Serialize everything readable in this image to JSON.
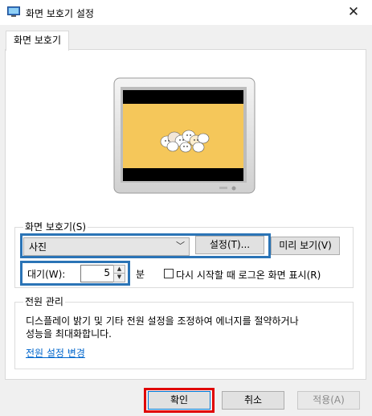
{
  "window": {
    "title": "화면 보호기 설정",
    "close_glyph": "✕"
  },
  "tabs": [
    {
      "label": "화면 보호기",
      "active": true
    }
  ],
  "screensaver": {
    "group_label": "화면 보호기(S)",
    "selected": "사진",
    "settings_button": "설정(T)...",
    "preview_button": "미리 보기(V)",
    "wait_label": "대기(W):",
    "wait_value": "5",
    "wait_unit": "분",
    "resume_checkbox_label": "다시 시작할 때 로그온 화면 표시(R)",
    "resume_checked": false
  },
  "power": {
    "group_label": "전원 관리",
    "description_line1": "디스플레이 밝기 및 기타 전원 설정을 조정하여 에너지를 절약하거나",
    "description_line2": "성능을 최대화합니다.",
    "link": "전원 설정 변경"
  },
  "footer": {
    "ok": "확인",
    "cancel": "취소",
    "apply": "적용(A)"
  },
  "colors": {
    "highlight_blue": "#2b74b6",
    "highlight_red": "#e00000",
    "link": "#0066cc",
    "screen_yellow": "#f5c75a"
  }
}
